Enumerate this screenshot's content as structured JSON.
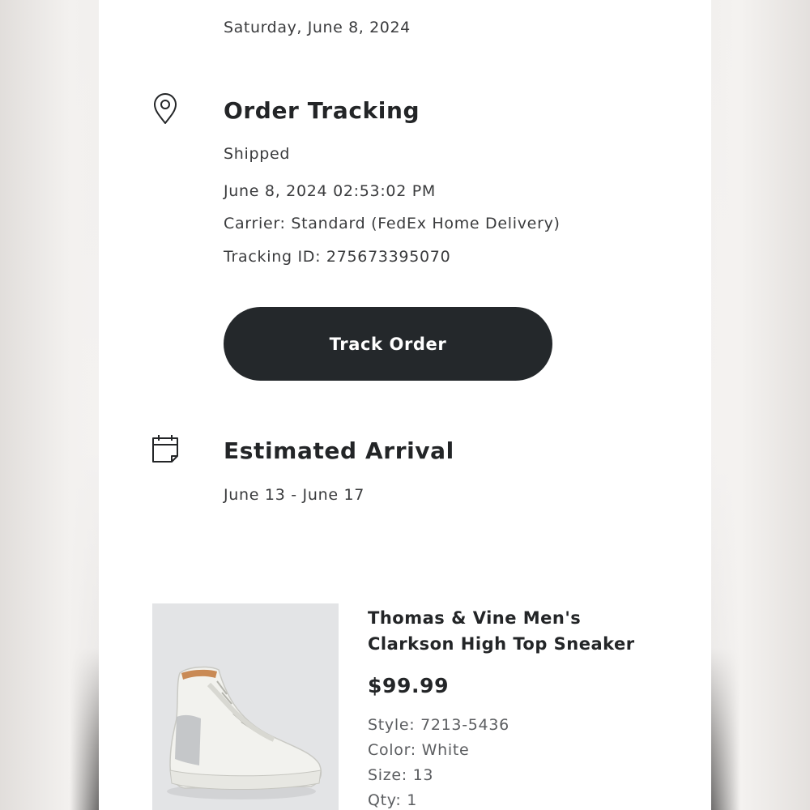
{
  "order": {
    "date": "Saturday, June 8, 2024"
  },
  "tracking": {
    "icon": "map-pin-icon",
    "title": "Order Tracking",
    "status": "Shipped",
    "timestamp": "June 8, 2024 02:53:02 PM",
    "carrier": "Carrier: Standard (FedEx Home Delivery)",
    "tracking_id": "Tracking ID: 275673395070",
    "button_label": "Track Order"
  },
  "arrival": {
    "icon": "calendar-icon",
    "title": "Estimated Arrival",
    "range": "June 13 - June 17"
  },
  "product": {
    "name": "Thomas & Vine Men's Clarkson High Top Sneaker",
    "price": "$99.99",
    "style": "Style: 7213-5436",
    "color": "Color: White",
    "size": "Size: 13",
    "qty": "Qty: 1"
  },
  "colors": {
    "button_bg": "#24282b",
    "text_primary": "#232527",
    "text_secondary": "#3a3b3d"
  }
}
